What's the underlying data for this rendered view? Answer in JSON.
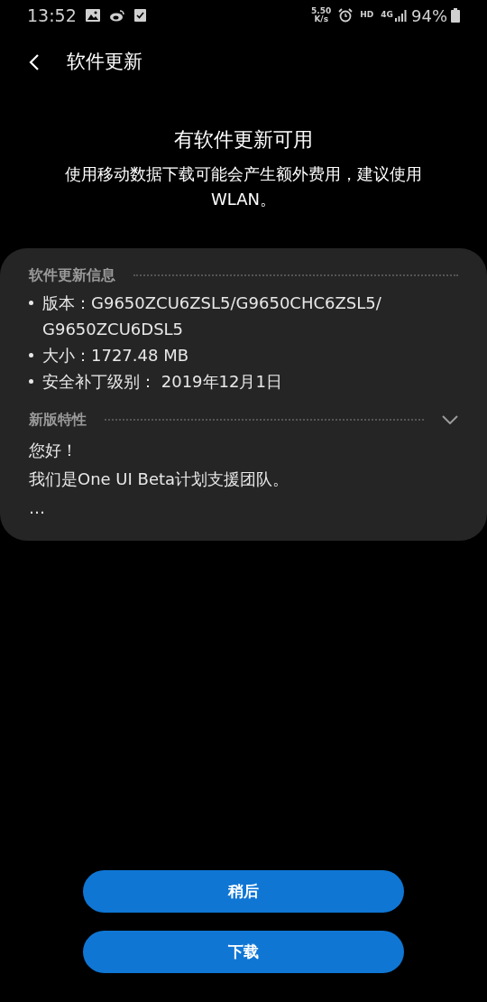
{
  "status_bar": {
    "time": "13:52",
    "speed_value": "5.50",
    "speed_unit": "K/s",
    "hd": "HD",
    "network": "4G",
    "battery": "94%"
  },
  "header": {
    "title": "软件更新"
  },
  "intro": {
    "title": "有软件更新可用",
    "message": "使用移动数据下载可能会产生额外费用，建议使用WLAN。"
  },
  "info_section": {
    "heading": "软件更新信息",
    "items": [
      "版本：G9650ZCU6ZSL5/G9650CHC6ZSL5/G9650ZCU6DSL5",
      "大小：1727.48 MB",
      "安全补丁级别： 2019年12月1日"
    ]
  },
  "features_section": {
    "heading": "新版特性",
    "expanded": false,
    "lines": [
      "您好！",
      "我们是One UI Beta计划支援团队。",
      "…"
    ]
  },
  "buttons": [
    {
      "label": "稍后"
    },
    {
      "label": "下载"
    }
  ]
}
